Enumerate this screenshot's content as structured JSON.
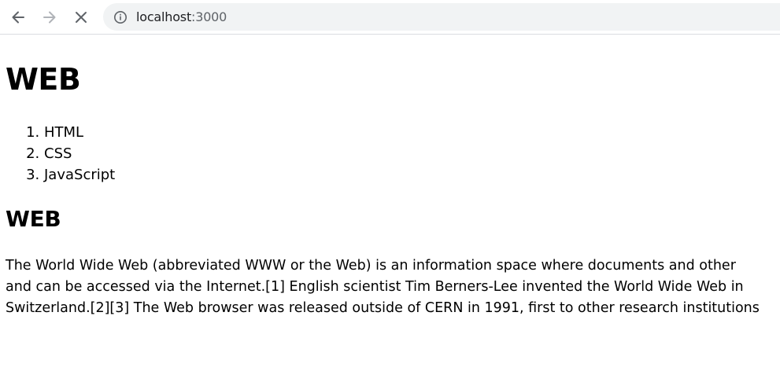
{
  "browser": {
    "url_host": "localhost",
    "url_port": ":3000",
    "icons": {
      "back": "arrow-left-icon",
      "forward": "arrow-right-icon",
      "stop": "close-icon",
      "site_info": "info-icon"
    }
  },
  "page": {
    "title": "WEB",
    "nav_items": [
      "HTML",
      "CSS",
      "JavaScript"
    ],
    "section_title": "WEB",
    "paragraph_lines": [
      "The World Wide Web (abbreviated WWW or the Web) is an information space where documents and other",
      "and can be accessed via the Internet.[1] English scientist Tim Berners-Lee invented the World Wide Web in",
      "Switzerland.[2][3] The Web browser was released outside of CERN in 1991, first to other research institutions"
    ]
  }
}
